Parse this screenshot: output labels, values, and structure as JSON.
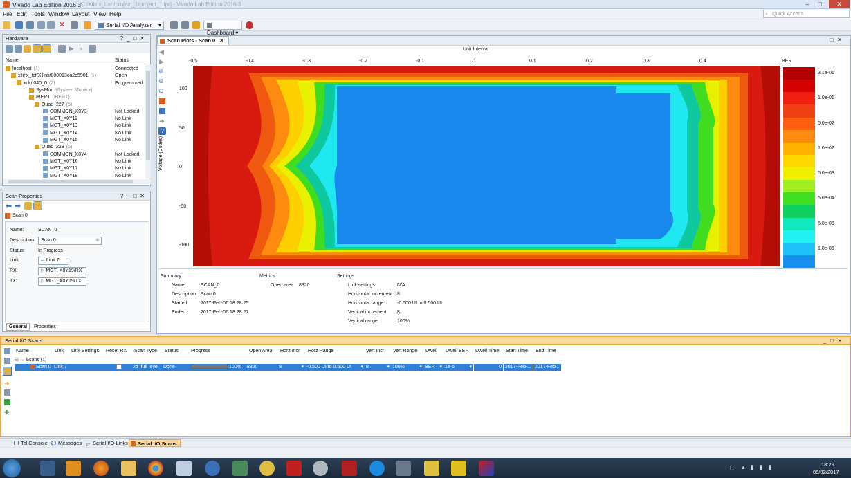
{
  "window": {
    "title": "Vivado Lab Edition 2016.3",
    "title_blur": "- [C:/Xilinx_Lab/project_1/project_1.lpr] - Vivado Lab Edition 2016.3"
  },
  "menu": [
    "File",
    "Edit",
    "Tools",
    "Window",
    "Layout",
    "View",
    "Help"
  ],
  "search": {
    "placeholder": "Quick Access"
  },
  "toolbar": {
    "mode": "Serial I/O Analyzer",
    "dashboard": "Dashboard"
  },
  "hardware": {
    "title": "Hardware",
    "col_name": "Name",
    "col_status": "Status",
    "rows": [
      {
        "name": "localhost",
        "count": "(1)",
        "status": "Connected"
      },
      {
        "name": "xilinx_tcf/Xilinx/000013ca2d5901",
        "count": "(1)",
        "status": "Open"
      },
      {
        "name": "xcku040_0",
        "count": "(2)",
        "status": "Programmed"
      },
      {
        "name": "SysMon",
        "count": "(System Monitor)",
        "status": ""
      },
      {
        "name": "IBERT",
        "count": "(IBERT)",
        "status": ""
      },
      {
        "name": "Quad_227",
        "count": "(5)",
        "status": ""
      },
      {
        "name": "COMMON_X0Y3",
        "count": "",
        "status": "Not Locked"
      },
      {
        "name": "MGT_X0Y12",
        "count": "",
        "status": "No Link"
      },
      {
        "name": "MGT_X0Y13",
        "count": "",
        "status": "No Link"
      },
      {
        "name": "MGT_X0Y14",
        "count": "",
        "status": "No Link"
      },
      {
        "name": "MGT_X0Y15",
        "count": "",
        "status": "No Link"
      },
      {
        "name": "Quad_228",
        "count": "(5)",
        "status": ""
      },
      {
        "name": "COMMON_X0Y4",
        "count": "",
        "status": "Not Locked"
      },
      {
        "name": "MGT_X0Y16",
        "count": "",
        "status": "No Link"
      },
      {
        "name": "MGT_X0Y17",
        "count": "",
        "status": "No Link"
      },
      {
        "name": "MGT_X0Y18",
        "count": "",
        "status": "No Link"
      }
    ]
  },
  "scan_props": {
    "title": "Scan Properties",
    "scan": "Scan 0",
    "labels": {
      "name": "Name:",
      "description": "Description:",
      "status": "Status:",
      "link": "Link:",
      "rx": "RX:",
      "tx": "TX:"
    },
    "values": {
      "name": "SCAN_0",
      "description": "Scan 0",
      "status": "In Progress",
      "link": "Link 7",
      "rx": "MGT_X0Y19/RX",
      "tx": "MGT_X0Y19/TX"
    },
    "tabs": [
      "General",
      "Properties"
    ]
  },
  "plot": {
    "tab": "Scan Plots - Scan 0",
    "xlabel": "Unit Interval",
    "ylabel": "Voltage (Codes)",
    "legend_title": "BER",
    "xticks": [
      "-0.5",
      "-0.4",
      "-0.3",
      "-0.2",
      "-0.1",
      "0",
      "0.1",
      "0.2",
      "0.3",
      "0.4"
    ],
    "yticks": [
      "100",
      "50",
      "0",
      "-50",
      "-100"
    ],
    "legend": [
      {
        "label": "3.1e-01",
        "color": "#b30000"
      },
      {
        "label": "",
        "color": "#d40000"
      },
      {
        "label": "1.0e-01",
        "color": "#f02010"
      },
      {
        "label": "",
        "color": "#f04010"
      },
      {
        "label": "5.0e-02",
        "color": "#ff6010"
      },
      {
        "label": "",
        "color": "#ff8a10"
      },
      {
        "label": "1.0e-02",
        "color": "#ffb000"
      },
      {
        "label": "",
        "color": "#ffd800"
      },
      {
        "label": "5.0e-03",
        "color": "#f0f000"
      },
      {
        "label": "",
        "color": "#a0ee20"
      },
      {
        "label": "5.0e-04",
        "color": "#40e020"
      },
      {
        "label": "",
        "color": "#10d060"
      },
      {
        "label": "5.0e-05",
        "color": "#10e8c0"
      },
      {
        "label": "",
        "color": "#20f0f0"
      },
      {
        "label": "1.0e-06",
        "color": "#20c0f8"
      },
      {
        "label": "",
        "color": "#1890f0"
      }
    ]
  },
  "summary": {
    "headers": [
      "Summary",
      "Metrics",
      "Settings"
    ],
    "labels": [
      "Name:",
      "Description:",
      "Started:",
      "Ended:"
    ],
    "values": [
      "SCAN_0",
      "Scan 0",
      "2017-Feb-06 18:28:25",
      "2017-Feb-06 18:28:27"
    ],
    "metric_label": "Open area:",
    "metric_value": "8320",
    "settings_labels": [
      "Link settings:",
      "Horizontal increment:",
      "Horizontal range:",
      "Vertical increment:",
      "Vertical range:"
    ],
    "settings_values": [
      "N/A",
      "8",
      "-0.500 UI to 0.500 UI",
      "8",
      "100%"
    ]
  },
  "scans": {
    "title": "Serial I/O Scans",
    "columns": [
      "Name",
      "Link",
      "Link Settings",
      "Reset RX",
      "Scan Type",
      "Status",
      "Progress",
      "Open Area",
      "Horz Incr",
      "Horz Range",
      "Vert Incr",
      "Vert Range",
      "Dwell",
      "Dwell BER",
      "Dwell Time",
      "Start Time",
      "End Time"
    ],
    "group": "Scans (1)",
    "row": {
      "name": "Scan 0",
      "link": "Link 7",
      "scan_type": "2d_full_eye",
      "status": "Done",
      "progress": "100%",
      "progress_value": 1.0,
      "open_area": "8320",
      "horz_incr": "8",
      "horz_range": "-0.500 UI to 0.500 UI",
      "vert_incr": "8",
      "vert_range": "100%",
      "dwell": "BER",
      "dwell_ber": "1e-5",
      "dwell_time": "0",
      "start_time": "2017-Feb-...",
      "end_time": "2017-Feb..."
    }
  },
  "bottom_tabs": [
    "Tcl Console",
    "Messages",
    "Serial I/O Links",
    "Serial I/O Scans"
  ],
  "taskbar": {
    "lang": "IT",
    "time": "18:29",
    "date": "06/02/2017"
  }
}
